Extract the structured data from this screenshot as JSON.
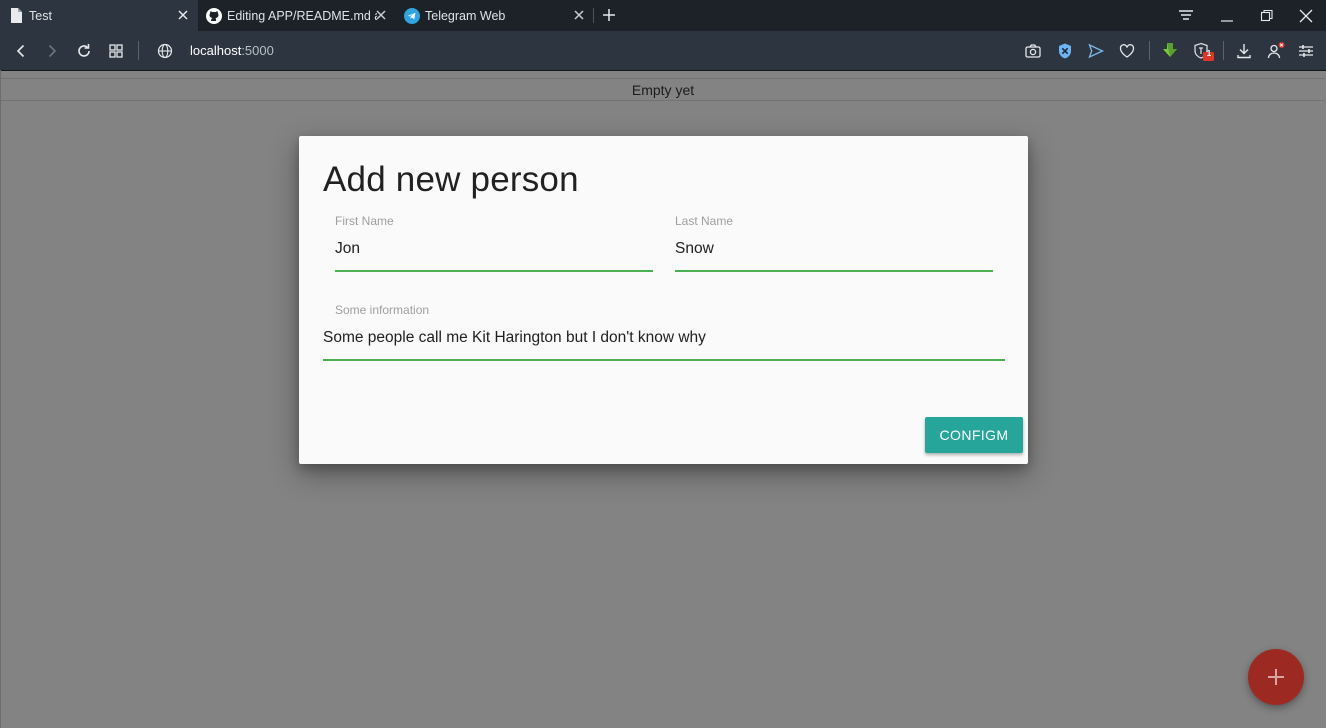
{
  "browser": {
    "tabs": [
      {
        "label": "Test",
        "icon": "document-icon",
        "active": true
      },
      {
        "label": "Editing APP/README.md at",
        "icon": "github-icon",
        "active": false
      },
      {
        "label": "Telegram Web",
        "icon": "telegram-icon",
        "active": false
      }
    ],
    "address": {
      "host": "localhost",
      "port": ":5000"
    },
    "extension_badge": "1"
  },
  "page": {
    "header_text": "Empty yet"
  },
  "dialog": {
    "title": "Add new person",
    "first_name": {
      "label": "First Name",
      "value": "Jon"
    },
    "last_name": {
      "label": "Last Name",
      "value": "Snow"
    },
    "info": {
      "label": "Some information",
      "value": "Some people call me Kit Harington but I don't know why"
    },
    "confirm_label": "CONFIGM"
  },
  "colors": {
    "accent_teal": "#26a69a",
    "input_underline_green": "#4caf50",
    "fab_red": "#9c2a22",
    "overlay_gray": "#838383"
  }
}
